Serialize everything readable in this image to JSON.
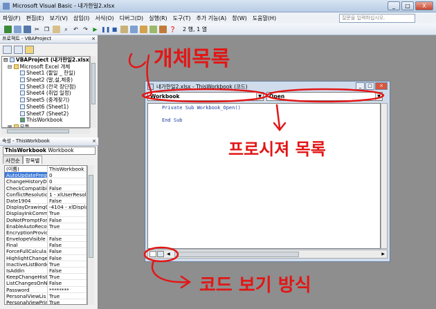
{
  "window": {
    "title": "Microsoft Visual Basic - 내가한일2.xlsx",
    "min": "_",
    "max": "□",
    "close": "X"
  },
  "menu": [
    "파일(F)",
    "편집(E)",
    "보기(V)",
    "삽입(I)",
    "서식(O)",
    "디버그(D)",
    "실행(R)",
    "도구(T)",
    "추가 기능(A)",
    "창(W)",
    "도움말(H)"
  ],
  "help_placeholder": "질문을 입력하십시오.",
  "toolbar": {
    "position": "2 행, 1 열"
  },
  "project": {
    "header": "프로젝트 - VBAProject",
    "items": [
      "VBAProject (내가한일2.xlsx)",
      "Microsoft Excel 개체",
      "Sheet1 (할일 _ 한일)",
      "Sheet2 (말,설,체중)",
      "Sheet3 (전국 장단점)",
      "Sheet4 (취업 일정)",
      "Sheet5 (중계찾기)",
      "Sheet6 (Sheet1)",
      "Sheet7 (Sheet2)",
      "ThisWorkbook",
      "모듈"
    ]
  },
  "properties": {
    "header": "속성 - ThisWorkbook",
    "object_name": "ThisWorkbook",
    "object_type": "Workbook",
    "tabs": [
      "사전순",
      "항목별"
    ],
    "rows": [
      [
        "(이름)",
        "ThisWorkbook"
      ],
      [
        "AutoUpdateFrequ",
        "0"
      ],
      [
        "ChangeHistoryDu",
        "0"
      ],
      [
        "CheckCompatibil",
        "False"
      ],
      [
        "ConflictResolutio",
        "1 - xlUserResol"
      ],
      [
        "Date1904",
        "False"
      ],
      [
        "DisplayDrawingO",
        "-4104 - xlDispla"
      ],
      [
        "DisplayInkComm",
        "True"
      ],
      [
        "DoNotPromptFor",
        "False"
      ],
      [
        "EnableAutoRecov",
        "True"
      ],
      [
        "EncryptionProvid",
        ""
      ],
      [
        "EnvelopeVisible",
        "False"
      ],
      [
        "Final",
        "False"
      ],
      [
        "ForceFullCalcula",
        "False"
      ],
      [
        "HighlightChanges",
        "False"
      ],
      [
        "InactiveListBorde",
        "True"
      ],
      [
        "IsAddin",
        "False"
      ],
      [
        "KeepChangeHist",
        "True"
      ],
      [
        "ListChangesOnN",
        "False"
      ],
      [
        "Password",
        "********"
      ],
      [
        "PersonalViewLis",
        "True"
      ],
      [
        "PersonalViewPrin",
        "True"
      ]
    ]
  },
  "code_window": {
    "title": "내가한일2.xlsx - ThisWorkbook (코드)",
    "object_combo": "Workbook",
    "procedure_combo": "Open",
    "lines": [
      "Private Sub Workbook_Open()",
      "",
      "End Sub"
    ]
  },
  "annotations": {
    "object_list": "개체목록",
    "procedure_list": "프로시져 목록",
    "view_mode": "코드 보기 방식",
    "color": "#e21616"
  }
}
